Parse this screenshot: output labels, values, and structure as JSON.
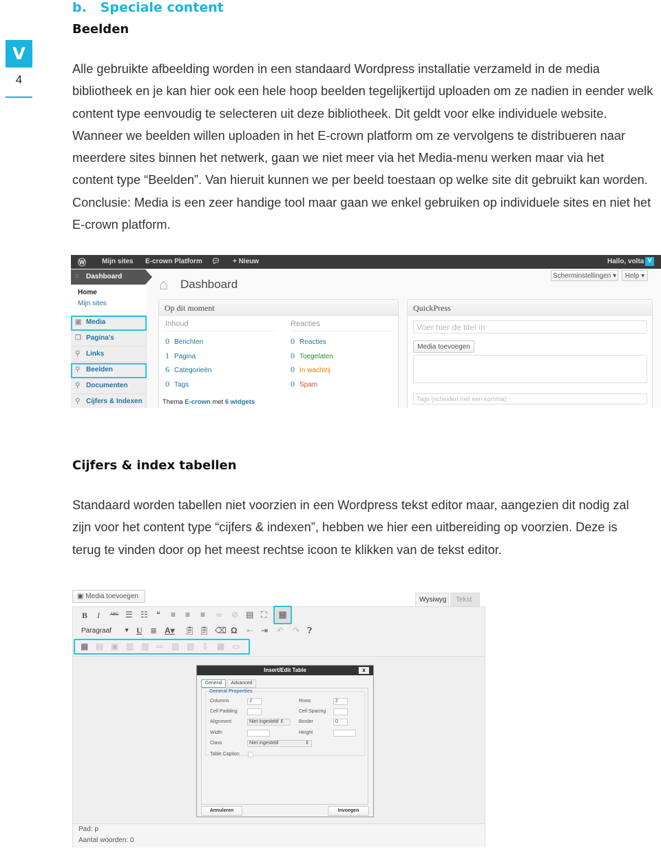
{
  "section_heading": "b.   Speciale content",
  "brand": {
    "logo_letter": "V",
    "accent": "#1bb4e0"
  },
  "page_number": "4",
  "beelden": {
    "title": "Beelden",
    "lines": [
      "Alle gebruikte afbeelding worden in een standaard Wordpress installatie verzameld in de media",
      "bibliotheek en je kan hier ook een hele hoop beelden tegelijkertijd uploaden om ze nadien in eender welk",
      "content type eenvoudig te selecteren uit deze bibliotheek. Dit geldt voor elke individuele website.",
      "Wanneer we beelden willen uploaden in het E-crown platform om ze vervolgens te distribueren naar",
      "meerdere sites binnen het netwerk, gaan we niet meer via het Media-menu werken maar via het",
      "content type “Beelden”. Van hieruit kunnen we per beeld toestaan op welke site dit gebruikt kan worden.",
      "Conclusie: Media is een zeer handige tool maar gaan we enkel gebruiken op individuele sites en niet het",
      "E-crown platform."
    ]
  },
  "dashboard": {
    "adminbar": {
      "items": [
        "Mijn sites",
        "E-crown Platform",
        "+ Nieuw"
      ],
      "greeting": "Hallo, volta"
    },
    "sidebar": {
      "dashboard": "Dashboard",
      "home": "Home",
      "mijn_sites": "Mijn sites",
      "items": [
        "Media",
        "Pagina's",
        "Links",
        "Beelden",
        "Documenten",
        "Cijfers & Indexen"
      ]
    },
    "title": "Dashboard",
    "screen_options": "Scherminstellingen",
    "help": "Help",
    "now": {
      "title": "Op dit moment",
      "content_header": "Inhoud",
      "comments_header": "Reacties",
      "content": [
        {
          "n": "0",
          "label": "Berichten"
        },
        {
          "n": "1",
          "label": "Pagina"
        },
        {
          "n": "6",
          "label": "Categorieën"
        },
        {
          "n": "0",
          "label": "Tags"
        }
      ],
      "comments": [
        {
          "n": "0",
          "label": "Reacties",
          "color": "#21759b"
        },
        {
          "n": "0",
          "label": "Toegelaten",
          "color": "#2e8b2e"
        },
        {
          "n": "0",
          "label": "In wachtrij",
          "color": "#d98500"
        },
        {
          "n": "0",
          "label": "Spam",
          "color": "#d54e21"
        }
      ],
      "theme_prefix": "Thema ",
      "theme_name": "E-crown",
      "theme_mid": " met ",
      "theme_widgets": "6 widgets"
    },
    "quickpress": {
      "title": "QuickPress",
      "title_placeholder": "Voer hier de titel in",
      "media_button": "Media toevoegen",
      "tags_placeholder": "Tags (scheiden met een komma)"
    }
  },
  "cijfers": {
    "title": "Cijfers & index tabellen",
    "lines": [
      "Standaard worden tabellen niet voorzien in een Wordpress tekst editor maar, aangezien dit nodig zal",
      "zijn voor het content type “cijfers & indexen”, hebben we hier een uitbereiding op voorzien. Deze is",
      "terug te vinden door op het meest rechtse icoon te klikken van de tekst editor."
    ]
  },
  "editor": {
    "media_button": "Media toevoegen",
    "tabs": [
      "Wysiwyg",
      "Tekst"
    ],
    "format_select": "Paragraaf",
    "path": "Pad: p",
    "word_count": "Aantal woorden: 0",
    "dialog": {
      "title": "Insert/Edit Table",
      "close": "x",
      "tabs": [
        "General",
        "Advanced"
      ],
      "fieldset": "General Properties",
      "columns_label": "Columns",
      "columns": "2",
      "rows_label": "Rows",
      "rows": "2",
      "cell_padding_label": "Cell Padding",
      "cell_spacing_label": "Cell Spacing",
      "alignment_label": "Alignment",
      "alignment": "Niet ingesteld",
      "border_label": "Border",
      "border": "0",
      "width_label": "Width",
      "height_label": "Height",
      "class_label": "Class",
      "class": "Niet ingesteld",
      "caption_label": "Table Caption",
      "cancel": "Annuleren",
      "insert": "Invoegen"
    }
  }
}
